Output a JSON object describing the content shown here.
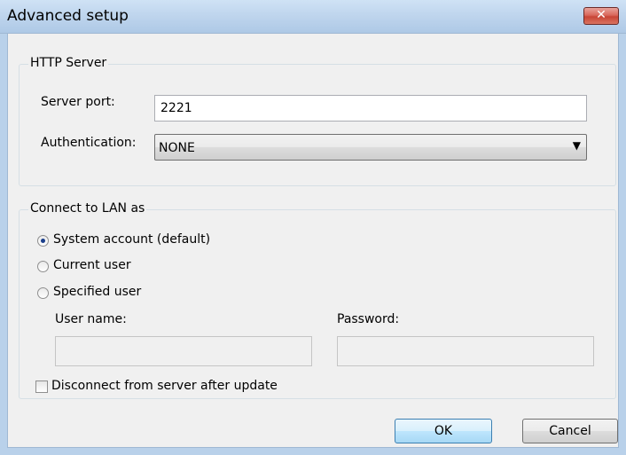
{
  "window": {
    "title": "Advanced setup",
    "close_glyph": "✕"
  },
  "http_server": {
    "legend": "HTTP Server",
    "port_label": "Server port:",
    "port_value": "2221",
    "auth_label": "Authentication:",
    "auth_value": "NONE",
    "auth_arrow": "▼"
  },
  "lan": {
    "legend": "Connect to LAN as",
    "options": [
      {
        "label": "System account (default)",
        "selected": true
      },
      {
        "label": "Current user",
        "selected": false
      },
      {
        "label": "Specified user",
        "selected": false
      }
    ],
    "username_label": "User name:",
    "username_value": "",
    "password_label": "Password:",
    "password_value": "",
    "disconnect_label": "Disconnect from server after update",
    "disconnect_checked": false
  },
  "buttons": {
    "ok": "OK",
    "cancel": "Cancel"
  },
  "colors": {
    "titlebar": "#bcd3ec",
    "client": "#f0f0f0",
    "close": "#c84536"
  }
}
